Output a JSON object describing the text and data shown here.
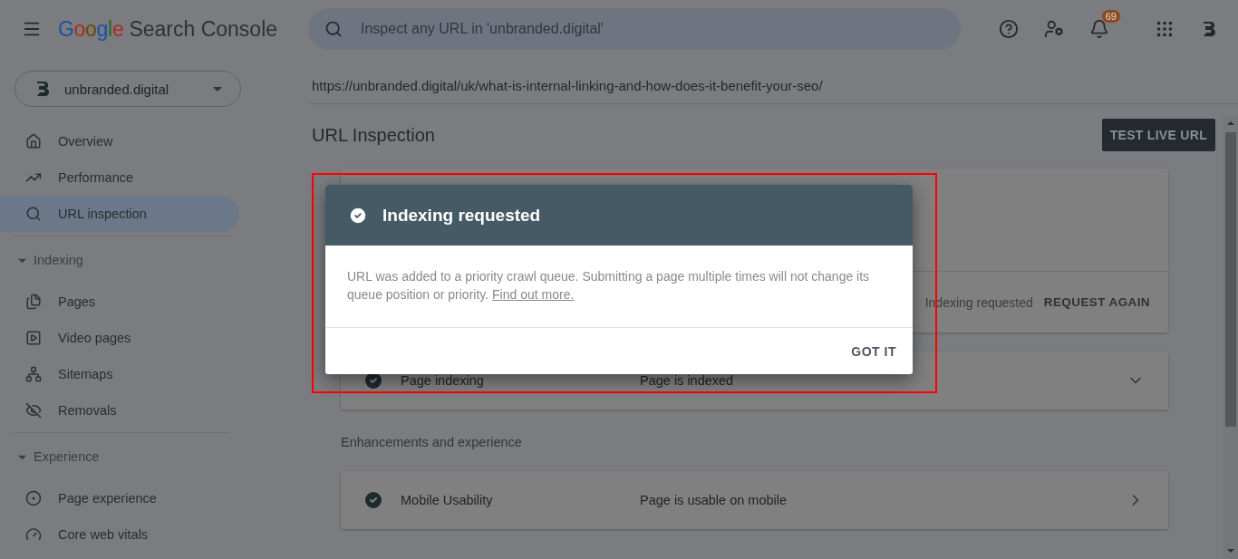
{
  "header": {
    "logo_word": "Google",
    "product": "Search Console",
    "search": {
      "placeholder": "Inspect any URL in 'unbranded.digital'"
    },
    "notifications_badge": "69"
  },
  "property": {
    "name": "unbranded.digital"
  },
  "sidebar": {
    "items": [
      {
        "kind": "item",
        "label": "Overview",
        "selected": false
      },
      {
        "kind": "item",
        "label": "Performance",
        "selected": false
      },
      {
        "kind": "item",
        "label": "URL inspection",
        "selected": true
      },
      {
        "kind": "section",
        "label": "Indexing",
        "expanded": true
      },
      {
        "kind": "item",
        "label": "Pages",
        "selected": false
      },
      {
        "kind": "item",
        "label": "Video pages",
        "selected": false
      },
      {
        "kind": "item",
        "label": "Sitemaps",
        "selected": false
      },
      {
        "kind": "item",
        "label": "Removals",
        "selected": false
      },
      {
        "kind": "section",
        "label": "Experience",
        "expanded": true
      },
      {
        "kind": "item",
        "label": "Page experience",
        "selected": false
      },
      {
        "kind": "item",
        "label": "Core web vitals",
        "selected": false
      }
    ]
  },
  "inspected_url": "https://unbranded.digital/uk/what-is-internal-linking-and-how-does-it-benefit-your-seo/",
  "page_title": "URL Inspection",
  "test_live_button": "TEST LIVE URL",
  "status_card": {
    "status": "Indexing requested",
    "action": "REQUEST AGAIN"
  },
  "results": [
    {
      "label": "Page indexing",
      "value": "Page is indexed",
      "kind": "expand"
    }
  ],
  "enhancements_heading": "Enhancements and experience",
  "enhancements": [
    {
      "label": "Mobile Usability",
      "value": "Page is usable on mobile",
      "kind": "link"
    }
  ],
  "dialog": {
    "title": "Indexing requested",
    "body": "URL was added to a priority crawl queue. Submitting a page multiple times will not change its queue position or priority.",
    "link": "Find out more.",
    "button": "GOT IT"
  }
}
